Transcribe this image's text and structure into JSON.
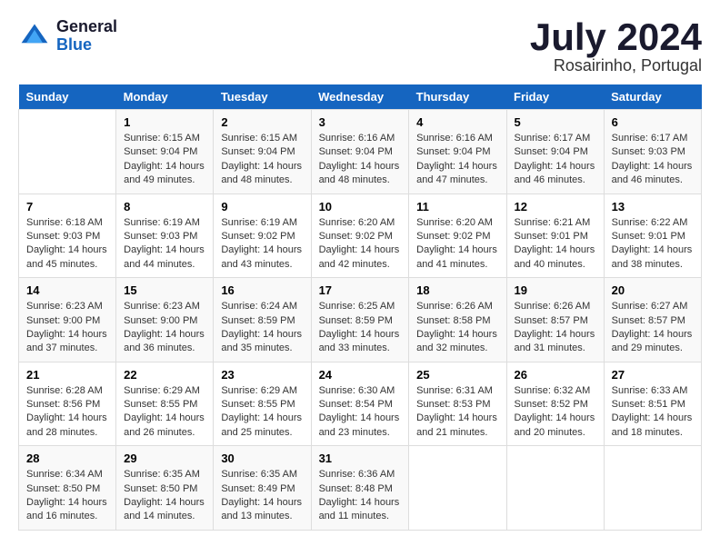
{
  "header": {
    "logo_general": "General",
    "logo_blue": "Blue",
    "title": "July 2024",
    "location": "Rosairinho, Portugal"
  },
  "weekdays": [
    "Sunday",
    "Monday",
    "Tuesday",
    "Wednesday",
    "Thursday",
    "Friday",
    "Saturday"
  ],
  "weeks": [
    [
      {
        "day": "",
        "sunrise": "",
        "sunset": "",
        "daylight": ""
      },
      {
        "day": "1",
        "sunrise": "Sunrise: 6:15 AM",
        "sunset": "Sunset: 9:04 PM",
        "daylight": "Daylight: 14 hours and 49 minutes."
      },
      {
        "day": "2",
        "sunrise": "Sunrise: 6:15 AM",
        "sunset": "Sunset: 9:04 PM",
        "daylight": "Daylight: 14 hours and 48 minutes."
      },
      {
        "day": "3",
        "sunrise": "Sunrise: 6:16 AM",
        "sunset": "Sunset: 9:04 PM",
        "daylight": "Daylight: 14 hours and 48 minutes."
      },
      {
        "day": "4",
        "sunrise": "Sunrise: 6:16 AM",
        "sunset": "Sunset: 9:04 PM",
        "daylight": "Daylight: 14 hours and 47 minutes."
      },
      {
        "day": "5",
        "sunrise": "Sunrise: 6:17 AM",
        "sunset": "Sunset: 9:04 PM",
        "daylight": "Daylight: 14 hours and 46 minutes."
      },
      {
        "day": "6",
        "sunrise": "Sunrise: 6:17 AM",
        "sunset": "Sunset: 9:03 PM",
        "daylight": "Daylight: 14 hours and 46 minutes."
      }
    ],
    [
      {
        "day": "7",
        "sunrise": "Sunrise: 6:18 AM",
        "sunset": "Sunset: 9:03 PM",
        "daylight": "Daylight: 14 hours and 45 minutes."
      },
      {
        "day": "8",
        "sunrise": "Sunrise: 6:19 AM",
        "sunset": "Sunset: 9:03 PM",
        "daylight": "Daylight: 14 hours and 44 minutes."
      },
      {
        "day": "9",
        "sunrise": "Sunrise: 6:19 AM",
        "sunset": "Sunset: 9:02 PM",
        "daylight": "Daylight: 14 hours and 43 minutes."
      },
      {
        "day": "10",
        "sunrise": "Sunrise: 6:20 AM",
        "sunset": "Sunset: 9:02 PM",
        "daylight": "Daylight: 14 hours and 42 minutes."
      },
      {
        "day": "11",
        "sunrise": "Sunrise: 6:20 AM",
        "sunset": "Sunset: 9:02 PM",
        "daylight": "Daylight: 14 hours and 41 minutes."
      },
      {
        "day": "12",
        "sunrise": "Sunrise: 6:21 AM",
        "sunset": "Sunset: 9:01 PM",
        "daylight": "Daylight: 14 hours and 40 minutes."
      },
      {
        "day": "13",
        "sunrise": "Sunrise: 6:22 AM",
        "sunset": "Sunset: 9:01 PM",
        "daylight": "Daylight: 14 hours and 38 minutes."
      }
    ],
    [
      {
        "day": "14",
        "sunrise": "Sunrise: 6:23 AM",
        "sunset": "Sunset: 9:00 PM",
        "daylight": "Daylight: 14 hours and 37 minutes."
      },
      {
        "day": "15",
        "sunrise": "Sunrise: 6:23 AM",
        "sunset": "Sunset: 9:00 PM",
        "daylight": "Daylight: 14 hours and 36 minutes."
      },
      {
        "day": "16",
        "sunrise": "Sunrise: 6:24 AM",
        "sunset": "Sunset: 8:59 PM",
        "daylight": "Daylight: 14 hours and 35 minutes."
      },
      {
        "day": "17",
        "sunrise": "Sunrise: 6:25 AM",
        "sunset": "Sunset: 8:59 PM",
        "daylight": "Daylight: 14 hours and 33 minutes."
      },
      {
        "day": "18",
        "sunrise": "Sunrise: 6:26 AM",
        "sunset": "Sunset: 8:58 PM",
        "daylight": "Daylight: 14 hours and 32 minutes."
      },
      {
        "day": "19",
        "sunrise": "Sunrise: 6:26 AM",
        "sunset": "Sunset: 8:57 PM",
        "daylight": "Daylight: 14 hours and 31 minutes."
      },
      {
        "day": "20",
        "sunrise": "Sunrise: 6:27 AM",
        "sunset": "Sunset: 8:57 PM",
        "daylight": "Daylight: 14 hours and 29 minutes."
      }
    ],
    [
      {
        "day": "21",
        "sunrise": "Sunrise: 6:28 AM",
        "sunset": "Sunset: 8:56 PM",
        "daylight": "Daylight: 14 hours and 28 minutes."
      },
      {
        "day": "22",
        "sunrise": "Sunrise: 6:29 AM",
        "sunset": "Sunset: 8:55 PM",
        "daylight": "Daylight: 14 hours and 26 minutes."
      },
      {
        "day": "23",
        "sunrise": "Sunrise: 6:29 AM",
        "sunset": "Sunset: 8:55 PM",
        "daylight": "Daylight: 14 hours and 25 minutes."
      },
      {
        "day": "24",
        "sunrise": "Sunrise: 6:30 AM",
        "sunset": "Sunset: 8:54 PM",
        "daylight": "Daylight: 14 hours and 23 minutes."
      },
      {
        "day": "25",
        "sunrise": "Sunrise: 6:31 AM",
        "sunset": "Sunset: 8:53 PM",
        "daylight": "Daylight: 14 hours and 21 minutes."
      },
      {
        "day": "26",
        "sunrise": "Sunrise: 6:32 AM",
        "sunset": "Sunset: 8:52 PM",
        "daylight": "Daylight: 14 hours and 20 minutes."
      },
      {
        "day": "27",
        "sunrise": "Sunrise: 6:33 AM",
        "sunset": "Sunset: 8:51 PM",
        "daylight": "Daylight: 14 hours and 18 minutes."
      }
    ],
    [
      {
        "day": "28",
        "sunrise": "Sunrise: 6:34 AM",
        "sunset": "Sunset: 8:50 PM",
        "daylight": "Daylight: 14 hours and 16 minutes."
      },
      {
        "day": "29",
        "sunrise": "Sunrise: 6:35 AM",
        "sunset": "Sunset: 8:50 PM",
        "daylight": "Daylight: 14 hours and 14 minutes."
      },
      {
        "day": "30",
        "sunrise": "Sunrise: 6:35 AM",
        "sunset": "Sunset: 8:49 PM",
        "daylight": "Daylight: 14 hours and 13 minutes."
      },
      {
        "day": "31",
        "sunrise": "Sunrise: 6:36 AM",
        "sunset": "Sunset: 8:48 PM",
        "daylight": "Daylight: 14 hours and 11 minutes."
      },
      {
        "day": "",
        "sunrise": "",
        "sunset": "",
        "daylight": ""
      },
      {
        "day": "",
        "sunrise": "",
        "sunset": "",
        "daylight": ""
      },
      {
        "day": "",
        "sunrise": "",
        "sunset": "",
        "daylight": ""
      }
    ]
  ]
}
